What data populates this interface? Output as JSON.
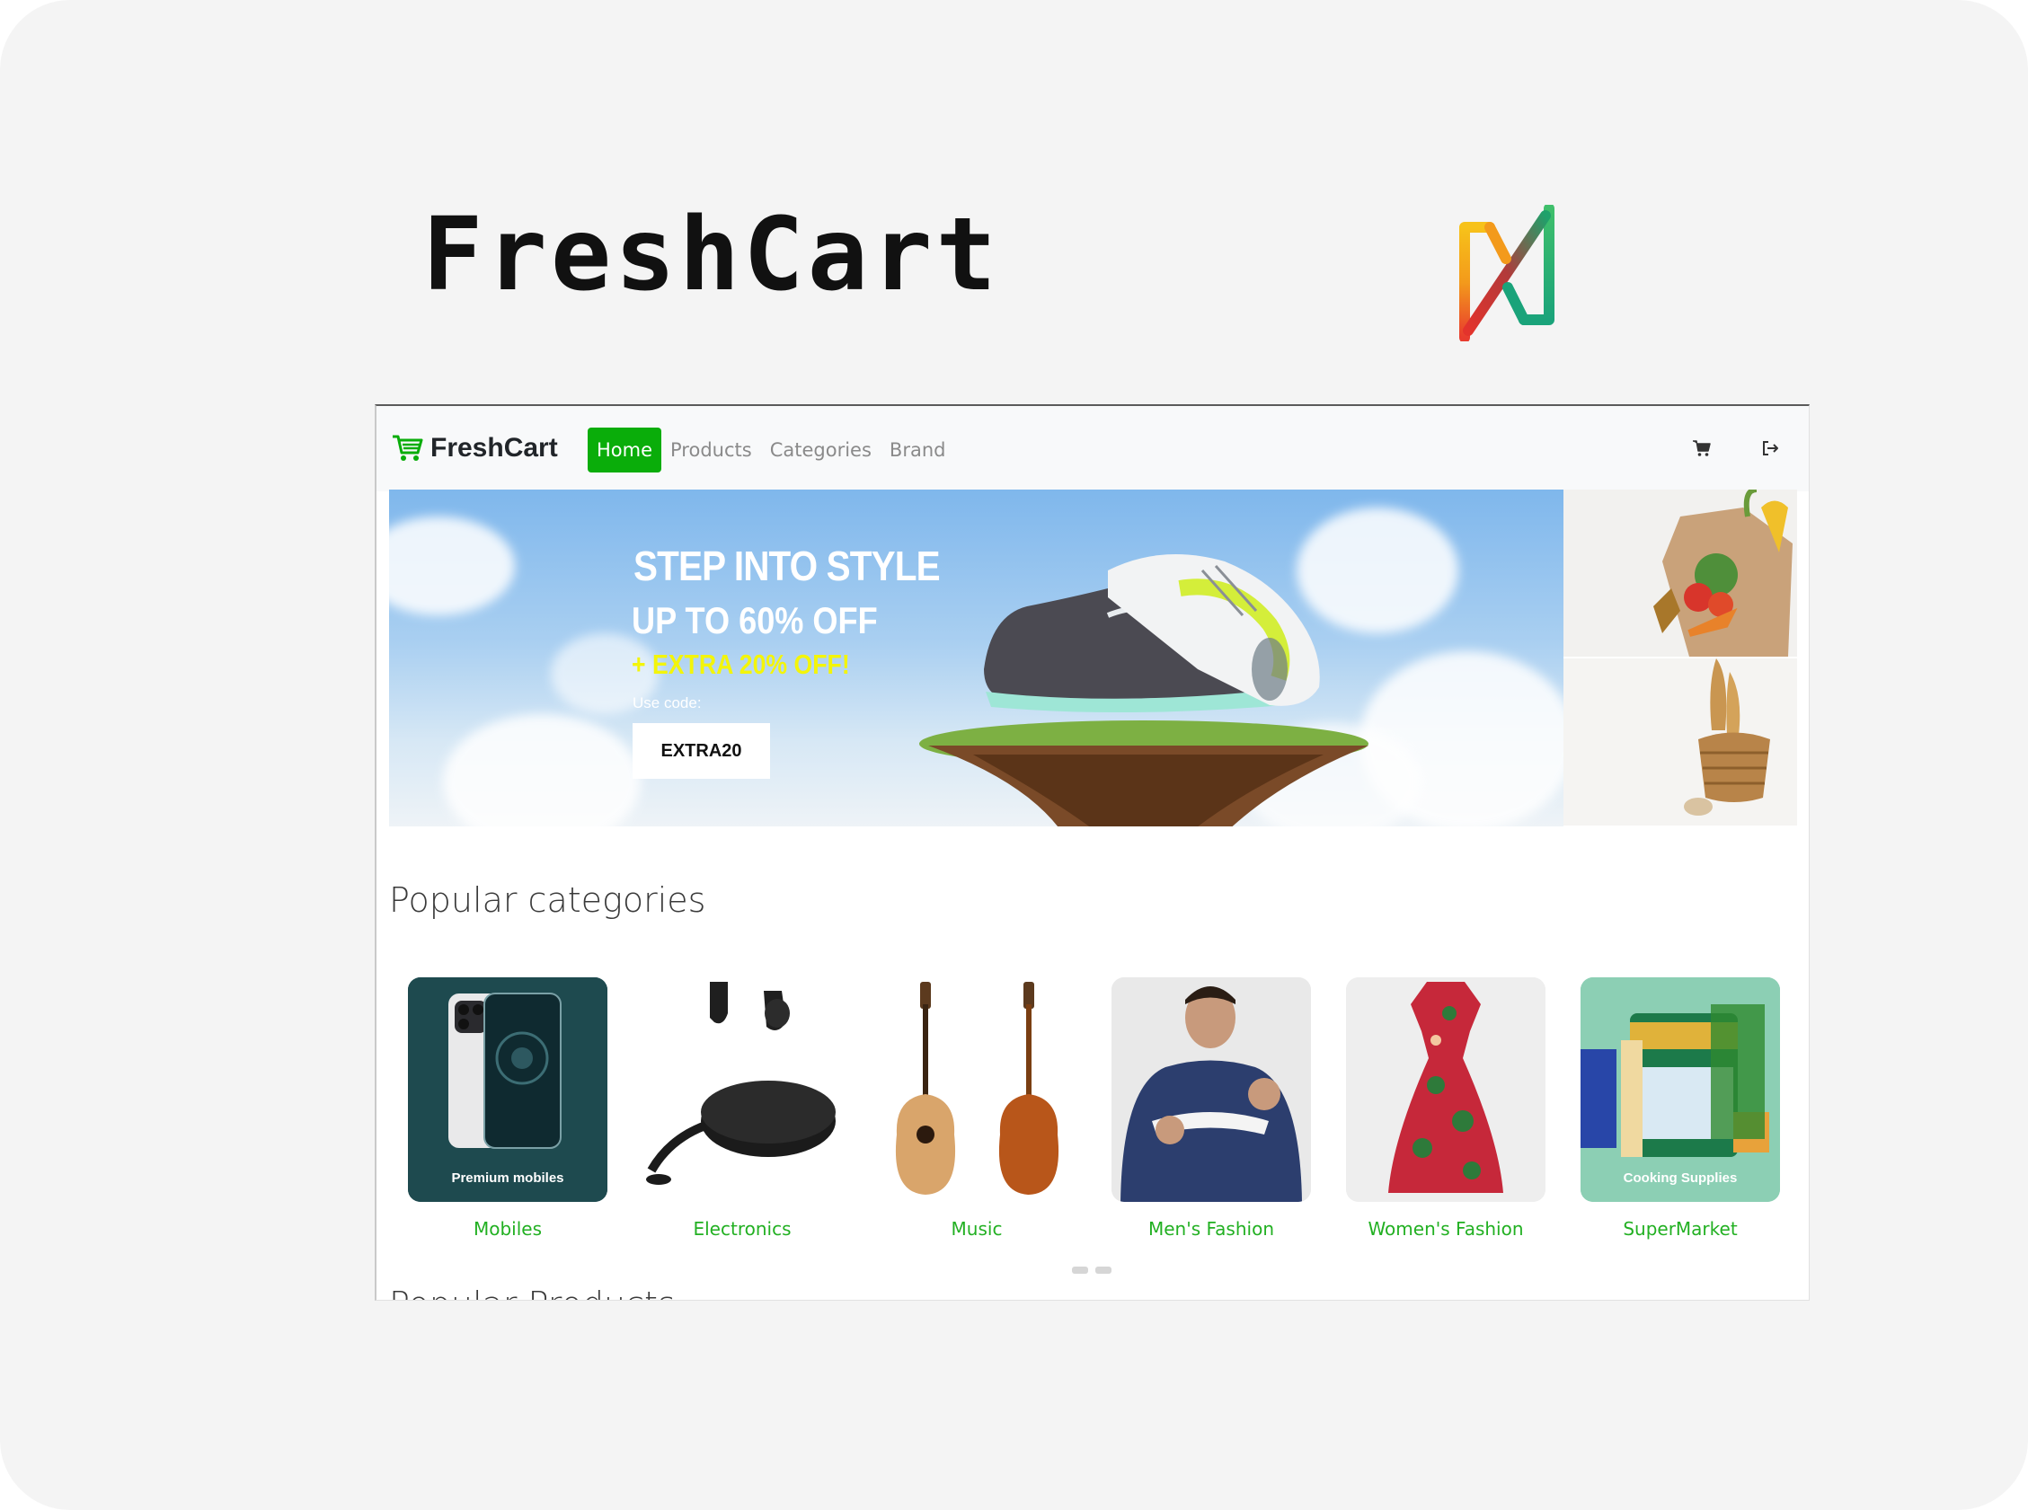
{
  "page": {
    "heading": "FreshCart"
  },
  "navbar": {
    "brand": "FreshCart",
    "links": [
      "Home",
      "Products",
      "Categories",
      "Brand"
    ],
    "active": "Home",
    "icons": [
      "cart-icon",
      "logout-icon"
    ]
  },
  "hero": {
    "headline": "STEP INTO STYLE",
    "offer": "UP TO 60% OFF",
    "extra": "+ EXTRA 20% OFF!",
    "use_code_label": "Use code:",
    "code": "EXTRA20"
  },
  "popular_categories": {
    "title": "Popular categories",
    "items": [
      {
        "label": "Mobiles",
        "caption": "Premium mobiles"
      },
      {
        "label": "Electronics",
        "caption": ""
      },
      {
        "label": "Music",
        "caption": ""
      },
      {
        "label": "Men's Fashion",
        "caption": ""
      },
      {
        "label": "Women's Fashion",
        "caption": ""
      },
      {
        "label": "SuperMarket",
        "caption": "Cooking Supplies"
      }
    ],
    "slider_dots": 2
  },
  "next_section": {
    "title": "Popular Products"
  },
  "colors": {
    "accent": "#0aad0a",
    "category_label": "#22b022",
    "offer_yellow": "#f3f50a"
  }
}
